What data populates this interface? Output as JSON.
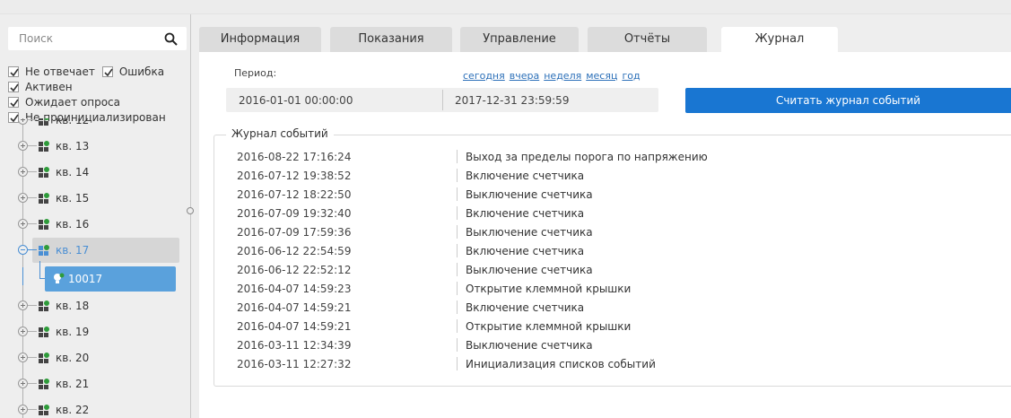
{
  "search": {
    "placeholder": "Поиск"
  },
  "filters": [
    {
      "label": "Не отвечает",
      "checked": true
    },
    {
      "label": "Ошибка",
      "checked": true
    },
    {
      "label": "Активен",
      "checked": true
    },
    {
      "label": "Ожидает опроса",
      "checked": true
    },
    {
      "label": "Не проинициализирован",
      "checked": true
    }
  ],
  "tree": {
    "items": [
      {
        "label": "кв. 12",
        "expanded": false
      },
      {
        "label": "кв. 13",
        "expanded": false
      },
      {
        "label": "кв. 14",
        "expanded": false
      },
      {
        "label": "кв. 15",
        "expanded": false
      },
      {
        "label": "кв. 16",
        "expanded": false
      },
      {
        "label": "кв. 17",
        "expanded": true,
        "selected": true
      },
      {
        "label": "кв. 18",
        "expanded": false
      },
      {
        "label": "кв. 19",
        "expanded": false
      },
      {
        "label": "кв. 20",
        "expanded": false
      },
      {
        "label": "кв. 21",
        "expanded": false
      },
      {
        "label": "кв. 22",
        "expanded": false
      }
    ],
    "child": {
      "label": "10017"
    }
  },
  "tabs": [
    {
      "label": "Информация",
      "active": false
    },
    {
      "label": "Показания",
      "active": false
    },
    {
      "label": "Управление",
      "active": false
    },
    {
      "label": "Отчёты",
      "active": false
    },
    {
      "label": "Журнал",
      "active": true
    }
  ],
  "period": {
    "label": "Период:",
    "quick": [
      "сегодня",
      "вчера",
      "неделя",
      "месяц",
      "год"
    ],
    "from": "2016-01-01 00:00:00",
    "to": "2017-12-31 23:59:59"
  },
  "read_button": "Считать журнал событий",
  "journal": {
    "title": "Журнал событий",
    "rows": [
      {
        "datetime": "2016-08-22 17:16:24",
        "event": "Выход за пределы порога по напряжению"
      },
      {
        "datetime": "2016-07-12 19:38:52",
        "event": "Включение счетчика"
      },
      {
        "datetime": "2016-07-12 18:22:50",
        "event": "Выключение счетчика"
      },
      {
        "datetime": "2016-07-09 19:32:40",
        "event": "Включение счетчика"
      },
      {
        "datetime": "2016-07-09 17:59:36",
        "event": "Выключение счетчика"
      },
      {
        "datetime": "2016-06-12 22:54:59",
        "event": "Включение счетчика"
      },
      {
        "datetime": "2016-06-12 22:52:12",
        "event": "Выключение счетчика"
      },
      {
        "datetime": "2016-04-07 14:59:23",
        "event": "Открытие клеммной крышки"
      },
      {
        "datetime": "2016-04-07 14:59:21",
        "event": "Включение счетчика"
      },
      {
        "datetime": "2016-04-07 14:59:21",
        "event": "Открытие клеммной крышки"
      },
      {
        "datetime": "2016-03-11 12:34:39",
        "event": "Выключение счетчика"
      },
      {
        "datetime": "2016-03-11 12:27:32",
        "event": "Инициализация списков событий"
      }
    ]
  },
  "colors": {
    "accent": "#1976d2",
    "selected_child": "#5aa1dc",
    "status_ok": "#2e9b3a"
  }
}
